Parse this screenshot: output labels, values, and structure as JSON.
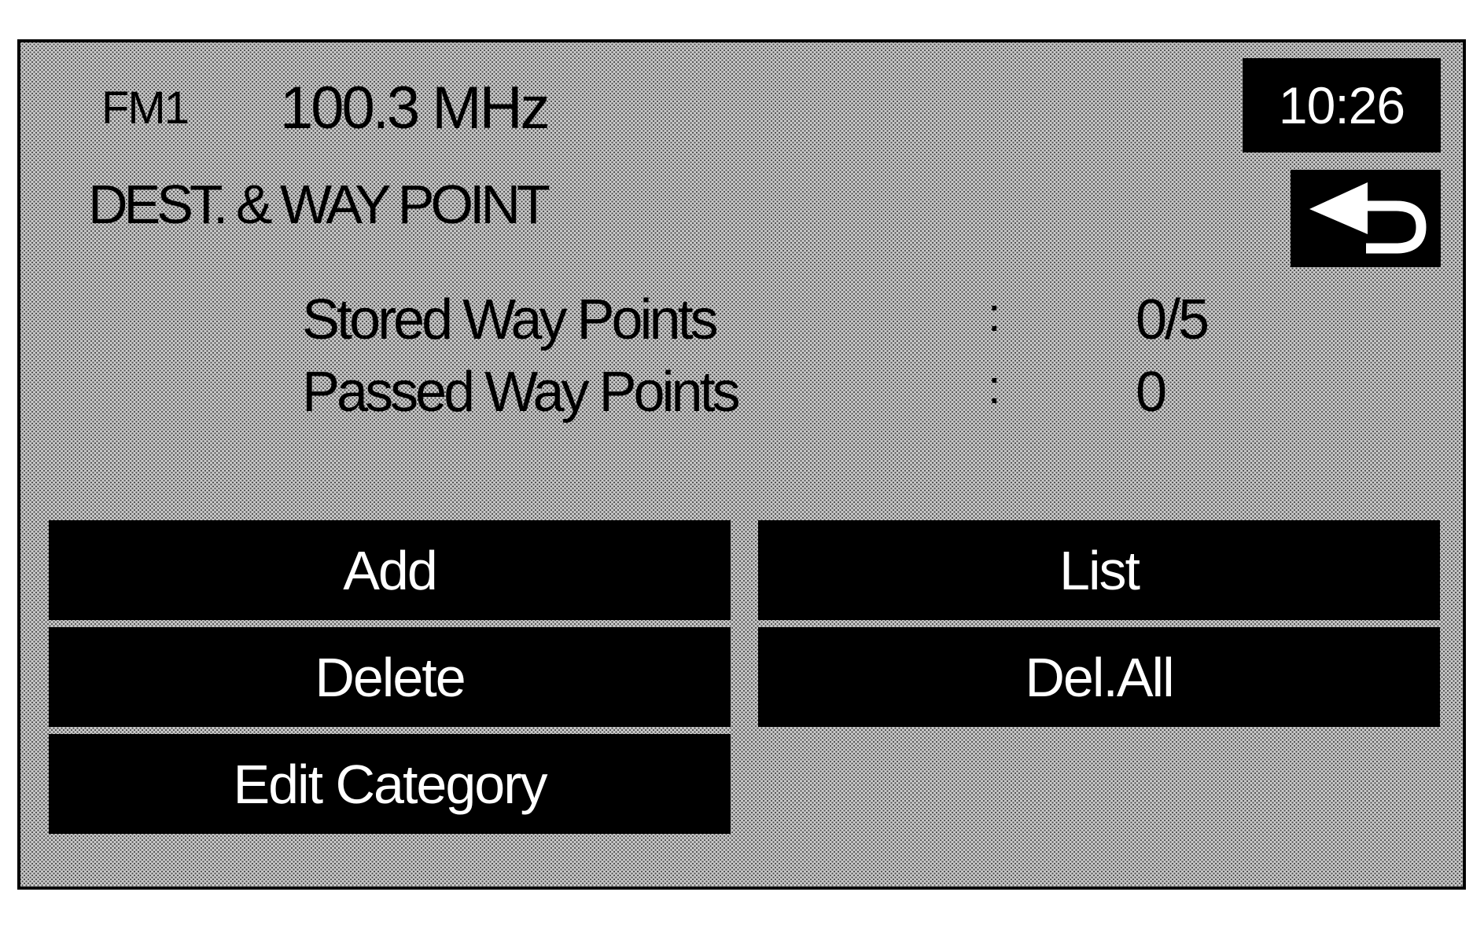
{
  "header": {
    "band": "FM1",
    "frequency": "100.3 MHz",
    "clock": "10:26"
  },
  "title": "DEST. & WAY POINT",
  "back_button": {
    "icon": "return-arrow-icon"
  },
  "info": {
    "rows": [
      {
        "label": "Stored Way Points",
        "separator": ":",
        "value": "0/5"
      },
      {
        "label": "Passed Way Points",
        "separator": ":",
        "value": "0"
      }
    ]
  },
  "buttons": {
    "add": "Add",
    "list": "List",
    "delete": "Delete",
    "delete_all": "Del.All",
    "edit_category": "Edit Category"
  },
  "colors": {
    "button_bg": "#000000",
    "button_text": "#ffffff",
    "screen_bg": "#c9c9c9"
  }
}
